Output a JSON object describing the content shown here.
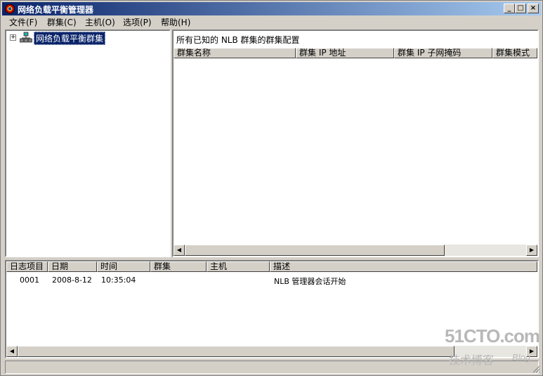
{
  "window": {
    "title": "网络负载平衡管理器",
    "controls": {
      "minimize": "_",
      "maximize": "□",
      "close": "×"
    }
  },
  "menu": [
    {
      "label": "文件(F)"
    },
    {
      "label": "群集(C)"
    },
    {
      "label": "主机(O)"
    },
    {
      "label": "选项(P)"
    },
    {
      "label": "帮助(H)"
    }
  ],
  "tree": {
    "expander": "+",
    "root_label": "网络负载平衡群集",
    "root_icon": "cluster-network-icon"
  },
  "cluster_view": {
    "caption": "所有已知的 NLB 群集的群集配置",
    "columns": [
      "群集名称",
      "群集 IP 地址",
      "群集 IP 子网掩码",
      "群集模式"
    ]
  },
  "log": {
    "columns": [
      "日志项目",
      "日期",
      "时间",
      "群集",
      "主机",
      "描述"
    ],
    "rows": [
      {
        "item": "0001",
        "date": "2008-8-12",
        "time": "10:35:04",
        "cluster": "",
        "host": "",
        "description": "NLB 管理器会话开始"
      }
    ]
  },
  "watermark": {
    "site": "51CTO.com",
    "tagline": "技术博客",
    "blog": "Blog"
  },
  "colors": {
    "titlebar_start": "#0a246a",
    "titlebar_end": "#a6caf0",
    "selection": "#0a246a",
    "chrome": "#d4d0c8"
  }
}
